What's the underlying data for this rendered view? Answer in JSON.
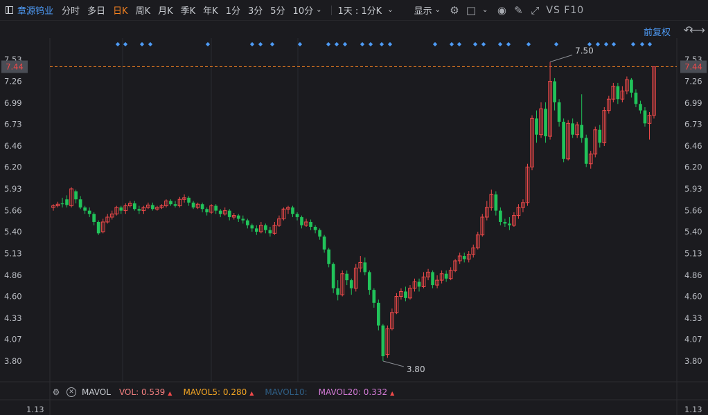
{
  "toolbar": {
    "stock_name": "章源钨业",
    "tabs": [
      "分时",
      "多日",
      "日K",
      "周K",
      "月K",
      "季K",
      "年K",
      "1分",
      "3分",
      "5分",
      "10分"
    ],
    "active_tab": "日K",
    "period_select": "1天 : 1分K",
    "show_label": "显示",
    "right_text": "VS F10"
  },
  "adjust_label": "前复权",
  "price_axis": {
    "left_ticks": [
      "7.53",
      "7.26",
      "6.99",
      "6.73",
      "6.46",
      "6.20",
      "5.93",
      "5.66",
      "5.40",
      "5.13",
      "4.86",
      "4.60",
      "4.33",
      "4.07",
      "3.80"
    ],
    "right_ticks": [
      "7.26",
      "6.99",
      "6.73",
      "6.46",
      "6.20",
      "5.93",
      "5.66",
      "5.40",
      "5.13",
      "4.86",
      "4.60",
      "4.33",
      "4.07",
      "3.80"
    ],
    "right_top_partial": "7.53"
  },
  "current_price": {
    "value": 7.44,
    "label": "7.44",
    "color": "#f04a4a"
  },
  "high_marker": {
    "label": "7.50",
    "value": 7.5
  },
  "low_marker": {
    "label": "3.80",
    "value": 3.8
  },
  "volume_panel": {
    "indicator": "MAVOL",
    "items": [
      {
        "label": "VOL:",
        "value": "0.539",
        "color": "#f58080"
      },
      {
        "label": "MAVOL5:",
        "value": "0.280",
        "color": "#f5a623"
      },
      {
        "label": "MAVOL10:",
        "value": "",
        "color": "#2f5f86"
      },
      {
        "label": "MAVOL20:",
        "value": "0.332",
        "color": "#d37ad6"
      }
    ],
    "left_tick": "1.13",
    "right_tick": "1.13"
  },
  "colors": {
    "up": "#f04a4a",
    "down": "#21c35a",
    "accent": "#f58220",
    "link": "#4e9bf6"
  },
  "chart_data": {
    "type": "candlestick",
    "y_range": [
      3.8,
      7.53
    ],
    "candles": [
      [
        5.7,
        5.72,
        5.66,
        5.74
      ],
      [
        5.72,
        5.74,
        5.7,
        5.77
      ],
      [
        5.75,
        5.74,
        5.7,
        5.82
      ],
      [
        5.8,
        5.73,
        5.7,
        5.85
      ],
      [
        5.72,
        5.93,
        5.7,
        5.95
      ],
      [
        5.9,
        5.8,
        5.75,
        5.92
      ],
      [
        5.8,
        5.7,
        5.68,
        5.84
      ],
      [
        5.7,
        5.66,
        5.62,
        5.72
      ],
      [
        5.66,
        5.62,
        5.58,
        5.7
      ],
      [
        5.62,
        5.52,
        5.48,
        5.64
      ],
      [
        5.52,
        5.38,
        5.36,
        5.54
      ],
      [
        5.4,
        5.52,
        5.38,
        5.56
      ],
      [
        5.52,
        5.58,
        5.5,
        5.62
      ],
      [
        5.58,
        5.62,
        5.55,
        5.66
      ],
      [
        5.62,
        5.7,
        5.6,
        5.72
      ],
      [
        5.7,
        5.66,
        5.62,
        5.72
      ],
      [
        5.66,
        5.72,
        5.62,
        5.75
      ],
      [
        5.72,
        5.75,
        5.7,
        5.78
      ],
      [
        5.75,
        5.68,
        5.66,
        5.78
      ],
      [
        5.68,
        5.66,
        5.62,
        5.72
      ],
      [
        5.66,
        5.7,
        5.62,
        5.72
      ],
      [
        5.7,
        5.73,
        5.68,
        5.76
      ],
      [
        5.73,
        5.68,
        5.66,
        5.76
      ],
      [
        5.68,
        5.7,
        5.66,
        5.72
      ],
      [
        5.7,
        5.72,
        5.68,
        5.74
      ],
      [
        5.72,
        5.78,
        5.7,
        5.8
      ],
      [
        5.78,
        5.74,
        5.72,
        5.8
      ],
      [
        5.74,
        5.72,
        5.7,
        5.78
      ],
      [
        5.72,
        5.8,
        5.7,
        5.83
      ],
      [
        5.8,
        5.82,
        5.76,
        5.86
      ],
      [
        5.82,
        5.76,
        5.72,
        5.84
      ],
      [
        5.76,
        5.7,
        5.68,
        5.78
      ],
      [
        5.7,
        5.74,
        5.68,
        5.76
      ],
      [
        5.74,
        5.68,
        5.64,
        5.76
      ],
      [
        5.68,
        5.64,
        5.6,
        5.7
      ],
      [
        5.64,
        5.72,
        5.62,
        5.74
      ],
      [
        5.72,
        5.66,
        5.62,
        5.74
      ],
      [
        5.66,
        5.62,
        5.58,
        5.68
      ],
      [
        5.62,
        5.66,
        5.6,
        5.7
      ],
      [
        5.66,
        5.58,
        5.54,
        5.68
      ],
      [
        5.58,
        5.6,
        5.55,
        5.63
      ],
      [
        5.6,
        5.56,
        5.52,
        5.62
      ],
      [
        5.56,
        5.54,
        5.5,
        5.6
      ],
      [
        5.54,
        5.48,
        5.44,
        5.56
      ],
      [
        5.48,
        5.44,
        5.4,
        5.5
      ],
      [
        5.44,
        5.4,
        5.36,
        5.48
      ],
      [
        5.4,
        5.48,
        5.38,
        5.52
      ],
      [
        5.48,
        5.42,
        5.38,
        5.5
      ],
      [
        5.42,
        5.38,
        5.34,
        5.46
      ],
      [
        5.38,
        5.48,
        5.36,
        5.52
      ],
      [
        5.48,
        5.56,
        5.46,
        5.6
      ],
      [
        5.56,
        5.68,
        5.54,
        5.7
      ],
      [
        5.68,
        5.7,
        5.62,
        5.72
      ],
      [
        5.7,
        5.62,
        5.58,
        5.72
      ],
      [
        5.62,
        5.58,
        5.54,
        5.64
      ],
      [
        5.58,
        5.48,
        5.44,
        5.6
      ],
      [
        5.48,
        5.52,
        5.46,
        5.56
      ],
      [
        5.52,
        5.46,
        5.42,
        5.55
      ],
      [
        5.46,
        5.42,
        5.38,
        5.48
      ],
      [
        5.42,
        5.34,
        5.3,
        5.44
      ],
      [
        5.34,
        5.18,
        5.14,
        5.36
      ],
      [
        5.18,
        5.0,
        4.96,
        5.2
      ],
      [
        5.0,
        4.7,
        4.64,
        5.02
      ],
      [
        4.7,
        4.62,
        4.55,
        4.8
      ],
      [
        4.62,
        4.88,
        4.6,
        4.92
      ],
      [
        4.88,
        4.8,
        4.74,
        4.92
      ],
      [
        4.8,
        4.7,
        4.62,
        4.82
      ],
      [
        4.7,
        4.95,
        4.66,
        5.0
      ],
      [
        4.95,
        5.02,
        4.9,
        5.1
      ],
      [
        5.02,
        4.9,
        4.86,
        5.08
      ],
      [
        4.9,
        4.68,
        4.62,
        4.92
      ],
      [
        4.68,
        4.52,
        4.46,
        4.7
      ],
      [
        4.52,
        4.24,
        4.18,
        4.56
      ],
      [
        4.24,
        3.86,
        3.8,
        4.26
      ],
      [
        3.88,
        4.2,
        3.84,
        4.24
      ],
      [
        4.2,
        4.4,
        4.18,
        4.45
      ],
      [
        4.4,
        4.6,
        4.38,
        4.64
      ],
      [
        4.6,
        4.66,
        4.56,
        4.7
      ],
      [
        4.66,
        4.58,
        4.54,
        4.72
      ],
      [
        4.58,
        4.7,
        4.56,
        4.74
      ],
      [
        4.7,
        4.78,
        4.66,
        4.82
      ],
      [
        4.78,
        4.72,
        4.66,
        4.82
      ],
      [
        4.72,
        4.84,
        4.7,
        4.9
      ],
      [
        4.84,
        4.9,
        4.8,
        4.94
      ],
      [
        4.9,
        4.74,
        4.7,
        4.92
      ],
      [
        4.74,
        4.8,
        4.7,
        4.86
      ],
      [
        4.8,
        4.88,
        4.76,
        4.92
      ],
      [
        4.88,
        4.82,
        4.78,
        4.92
      ],
      [
        4.82,
        4.92,
        4.8,
        4.96
      ],
      [
        4.92,
        5.04,
        4.9,
        5.06
      ],
      [
        5.04,
        5.1,
        5.0,
        5.14
      ],
      [
        5.1,
        5.06,
        5.02,
        5.14
      ],
      [
        5.06,
        5.12,
        5.02,
        5.16
      ],
      [
        5.12,
        5.2,
        5.08,
        5.24
      ],
      [
        5.2,
        5.36,
        5.18,
        5.4
      ],
      [
        5.36,
        5.58,
        5.34,
        5.62
      ],
      [
        5.58,
        5.7,
        5.54,
        5.78
      ],
      [
        5.7,
        5.86,
        5.66,
        5.92
      ],
      [
        5.86,
        5.66,
        5.6,
        5.9
      ],
      [
        5.66,
        5.52,
        5.48,
        5.7
      ],
      [
        5.52,
        5.5,
        5.46,
        5.56
      ],
      [
        5.5,
        5.48,
        5.42,
        5.58
      ],
      [
        5.48,
        5.6,
        5.46,
        5.64
      ],
      [
        5.6,
        5.7,
        5.56,
        5.74
      ],
      [
        5.7,
        5.76,
        5.64,
        5.8
      ],
      [
        5.76,
        6.2,
        5.72,
        6.24
      ],
      [
        6.2,
        6.8,
        6.16,
        6.84
      ],
      [
        6.8,
        6.6,
        6.5,
        6.9
      ],
      [
        6.6,
        6.92,
        6.56,
        7.0
      ],
      [
        6.92,
        6.58,
        6.5,
        7.0
      ],
      [
        6.58,
        7.26,
        6.54,
        7.5
      ],
      [
        7.26,
        7.0,
        6.9,
        7.3
      ],
      [
        7.0,
        6.76,
        6.7,
        7.04
      ],
      [
        6.76,
        6.3,
        6.26,
        6.8
      ],
      [
        6.3,
        6.74,
        6.28,
        6.78
      ],
      [
        6.74,
        6.6,
        6.56,
        6.8
      ],
      [
        6.6,
        6.72,
        6.56,
        6.76
      ],
      [
        6.72,
        6.56,
        6.5,
        7.1
      ],
      [
        6.56,
        6.24,
        6.2,
        6.6
      ],
      [
        6.24,
        6.36,
        6.18,
        6.4
      ],
      [
        6.36,
        6.66,
        6.32,
        6.7
      ],
      [
        6.66,
        6.5,
        6.44,
        6.72
      ],
      [
        6.5,
        6.9,
        6.46,
        6.94
      ],
      [
        6.9,
        7.04,
        6.86,
        7.08
      ],
      [
        7.04,
        7.2,
        7.0,
        7.24
      ],
      [
        7.2,
        7.04,
        6.98,
        7.24
      ],
      [
        7.04,
        7.14,
        7.0,
        7.2
      ],
      [
        7.14,
        7.28,
        7.1,
        7.32
      ],
      [
        7.28,
        7.12,
        7.06,
        7.3
      ],
      [
        7.12,
        6.98,
        6.94,
        7.16
      ],
      [
        6.98,
        6.9,
        6.86,
        7.02
      ],
      [
        6.9,
        6.74,
        6.7,
        6.94
      ],
      [
        6.74,
        6.84,
        6.54,
        6.88
      ],
      [
        6.84,
        7.44,
        6.8,
        7.44
      ]
    ]
  }
}
